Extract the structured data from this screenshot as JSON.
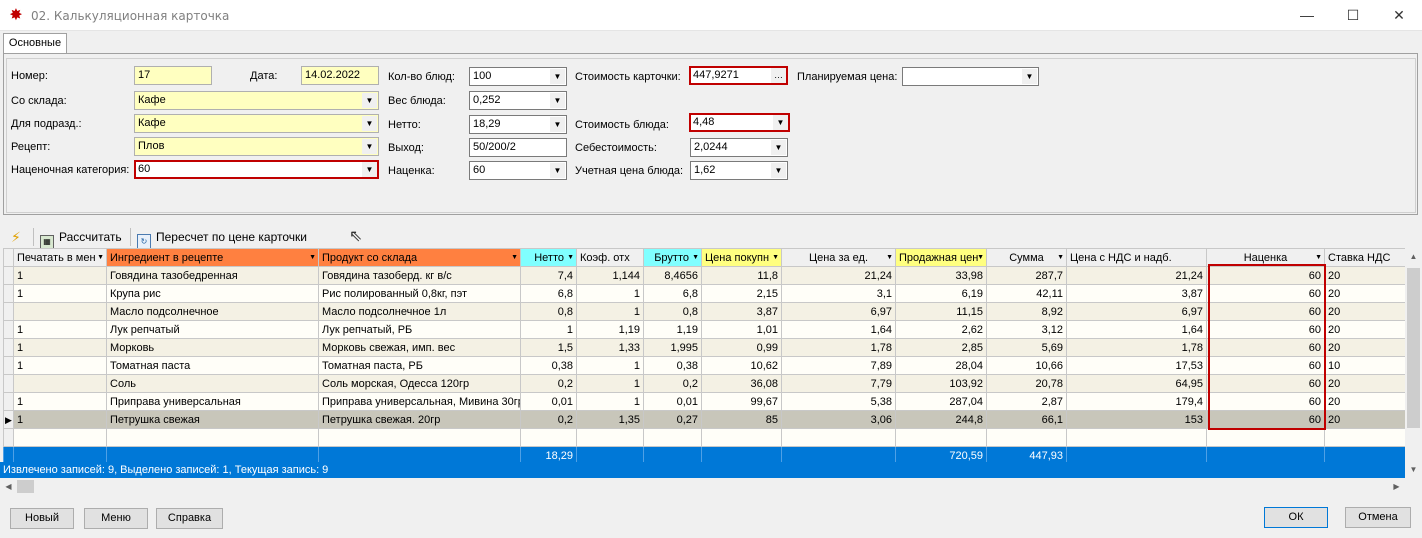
{
  "window": {
    "title": "02. Калькуляционная карточка",
    "minimize": "—",
    "maximize": "☐",
    "close": "✕"
  },
  "tabs": [
    {
      "label": "Основные"
    }
  ],
  "form": {
    "number": {
      "label": "Номер:",
      "value": "17"
    },
    "date": {
      "label": "Дата:",
      "value": "14.02.2022"
    },
    "warehouse": {
      "label": "Со склада:",
      "value": "Кафе"
    },
    "subdivision": {
      "label": "Для подразд.:",
      "value": "Кафе"
    },
    "recipe": {
      "label": "Рецепт:",
      "value": "Плов"
    },
    "markup_category": {
      "label": "Наценочная категория:",
      "value": "60"
    },
    "portions": {
      "label": "Кол-во блюд:",
      "value": "100"
    },
    "dish_weight": {
      "label": "Вес блюда:",
      "value": "0,252"
    },
    "netto": {
      "label": "Нетто:",
      "value": "18,29"
    },
    "output": {
      "label": "Выход:",
      "value": "50/200/2"
    },
    "markup": {
      "label": "Наценка:",
      "value": "60"
    },
    "card_cost": {
      "label": "Стоимость карточки:",
      "value": "447,9271"
    },
    "dish_cost": {
      "label": "Стоимость блюда:",
      "value": "4,48"
    },
    "prime_cost": {
      "label": "Себестоимость:",
      "value": "2,0244"
    },
    "accounting_price": {
      "label": "Учетная цена блюда:",
      "value": "1,62"
    },
    "planned_price": {
      "label": "Планируемая цена:",
      "value": ""
    }
  },
  "toolbar": {
    "calculate": "Рассчитать",
    "recalc": "Пересчет по цене карточки"
  },
  "grid": {
    "columns": [
      "Печатать в мен",
      "Ингредиент в рецепте",
      "Продукт со склада",
      "Нетто",
      "Коэф. отх",
      "Брутто",
      "Цена покупн",
      "Цена за ед.",
      "Продажная цен",
      "Сумма",
      "Цена с НДС и надб.",
      "Наценка",
      "Ставка НДС"
    ],
    "rows": [
      [
        "1",
        "Говядина тазобедренная",
        "Говядина тазоберд. кг в/с",
        "7,4",
        "1,144",
        "8,4656",
        "11,8",
        "21,24",
        "33,98",
        "287,7",
        "21,24",
        "60",
        "20"
      ],
      [
        "1",
        "Крупа рис",
        "Рис полированный 0,8кг, пэт",
        "6,8",
        "1",
        "6,8",
        "2,15",
        "3,1",
        "6,19",
        "42,11",
        "3,87",
        "60",
        "20"
      ],
      [
        "",
        "Масло подсолнечное",
        "Масло подсолнечное 1л",
        "0,8",
        "1",
        "0,8",
        "3,87",
        "6,97",
        "11,15",
        "8,92",
        "6,97",
        "60",
        "20"
      ],
      [
        "1",
        "Лук репчатый",
        "Лук репчатый, РБ",
        "1",
        "1,19",
        "1,19",
        "1,01",
        "1,64",
        "2,62",
        "3,12",
        "1,64",
        "60",
        "20"
      ],
      [
        "1",
        "Морковь",
        "Морковь свежая, имп. вес",
        "1,5",
        "1,33",
        "1,995",
        "0,99",
        "1,78",
        "2,85",
        "5,69",
        "1,78",
        "60",
        "20"
      ],
      [
        "1",
        "Томатная паста",
        "Томатная паста, РБ",
        "0,38",
        "1",
        "0,38",
        "10,62",
        "7,89",
        "28,04",
        "10,66",
        "17,53",
        "60",
        "10"
      ],
      [
        "",
        "Соль",
        "Соль морская, Одесса 120гр",
        "0,2",
        "1",
        "0,2",
        "36,08",
        "7,79",
        "103,92",
        "20,78",
        "64,95",
        "60",
        "20"
      ],
      [
        "1",
        "Приправа универсальная",
        "Приправа универсальная, Мивина 30гр",
        "0,01",
        "1",
        "0,01",
        "99,67",
        "5,38",
        "287,04",
        "2,87",
        "179,4",
        "60",
        "20"
      ],
      [
        "1",
        "Петрушка свежая",
        "Петрушка свежая. 20гр",
        "0,2",
        "1,35",
        "0,27",
        "85",
        "3,06",
        "244,8",
        "66,1",
        "153",
        "60",
        "20"
      ]
    ],
    "totals": {
      "netto": "18,29",
      "sale_price": "720,59",
      "sum": "447,93"
    },
    "current_row": 8
  },
  "status": "Извлечено записей: 9, Выделено записей: 1, Текущая запись: 9",
  "buttons": {
    "new": "Новый",
    "menu": "Меню",
    "help": "Справка",
    "ok": "ОК",
    "cancel": "Отмена"
  },
  "colors": {
    "accent": "#0078d7",
    "highlight_red": "#c00000",
    "field_yellow": "#ffffc0",
    "header_orange": "#ff8040",
    "header_cyan": "#80ffff",
    "header_yellow": "#ffff80"
  }
}
